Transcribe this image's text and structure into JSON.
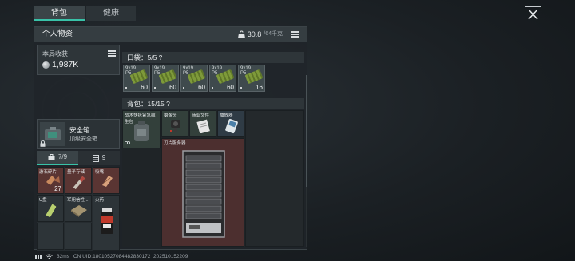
{
  "tabs": [
    {
      "label": "背包",
      "active": true
    },
    {
      "label": "健康",
      "active": false
    }
  ],
  "panel": {
    "title": "个人物资",
    "weight_value": "30.8",
    "weight_max": "/64千克"
  },
  "harvest": {
    "label": "本局收获",
    "value": "1,987K"
  },
  "safebox": {
    "name": "安全箱",
    "tier": "顶级安全箱"
  },
  "subtabs": [
    {
      "label": "7/9",
      "icon": "bag-icon",
      "active": true
    },
    {
      "label": "9",
      "icon": "box-icon",
      "active": false
    }
  ],
  "pocket_items": [
    {
      "label": "游石碎片",
      "count": "27"
    },
    {
      "label": "量子存储",
      "count": ""
    },
    {
      "label": "吸嘴",
      "count": ""
    },
    {
      "label": "U盘",
      "count": ""
    },
    {
      "label": "军用信性...",
      "count": ""
    },
    {
      "label": "火药",
      "count": ""
    }
  ],
  "pouch": {
    "label": "口袋：5/5  ?"
  },
  "ammo": [
    {
      "caliber": "9x19",
      "type": "P5",
      "count": "60"
    },
    {
      "caliber": "9x19",
      "type": "P5",
      "count": "60"
    },
    {
      "caliber": "9x19",
      "type": "P5",
      "count": "60"
    },
    {
      "caliber": "9x19",
      "type": "P5",
      "count": "60"
    },
    {
      "caliber": "9x19",
      "type": "P5",
      "count": "16"
    }
  ],
  "backpack": {
    "label": "背包：15/15  ?",
    "items": [
      {
        "label": "战术快拆紧急维生包"
      },
      {
        "label": "摄像头"
      },
      {
        "label": "商业文件"
      },
      {
        "label": "播放器"
      },
      {
        "label": "刀片服务器"
      }
    ]
  },
  "footer": {
    "ping": "32ms",
    "uid": "CN UID:18010527084482830172_202510152209"
  },
  "colors": {
    "accent": "#39c2a8",
    "rare_red": "#4c2f2f",
    "background": "#1b2024"
  }
}
